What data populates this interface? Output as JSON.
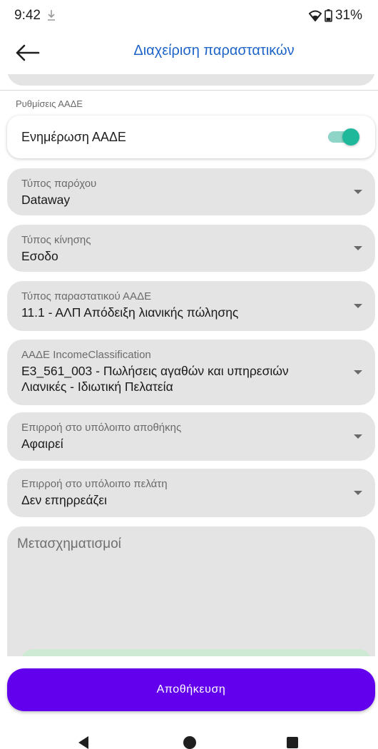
{
  "status_bar": {
    "time": "9:42",
    "battery": "31%"
  },
  "app_bar": {
    "title": "Διαχείριση παραστατικών"
  },
  "section": {
    "label": "Ρυθμίσεις ΑΑΔΕ"
  },
  "aade_update": {
    "label": "Ενημέρωση ΑΑΔΕ",
    "enabled": true
  },
  "fields": [
    {
      "label": "Τύπος παρόχου",
      "value": "Dataway"
    },
    {
      "label": "Τύπος κίνησης",
      "value": "Εσοδο"
    },
    {
      "label": "Τύπος παραστατικού ΑΑΔΕ",
      "value": "11.1 - ΑΛΠ Απόδειξη λιανικής πώλησης"
    },
    {
      "label": "ΑΑΔΕ IncomeClassification",
      "value": "Ε3_561_003 - Πωλήσεις αγαθών και υπηρεσιών Λιανικές - Ιδιωτική Πελατεία"
    },
    {
      "label": "Επιρροή στο υπόλοιπο αποθήκης",
      "value": "Αφαιρεί"
    },
    {
      "label": "Επιρροή στο υπόλοιπο πελάτη",
      "value": "Δεν επηρρεάζει"
    }
  ],
  "transformations": {
    "placeholder": "Μετασχηματισμοί"
  },
  "save_button": {
    "label": "Αποθήκευση"
  },
  "colors": {
    "accent": "#6200ee",
    "title": "#1e64c8",
    "toggle": "#20b89a"
  }
}
